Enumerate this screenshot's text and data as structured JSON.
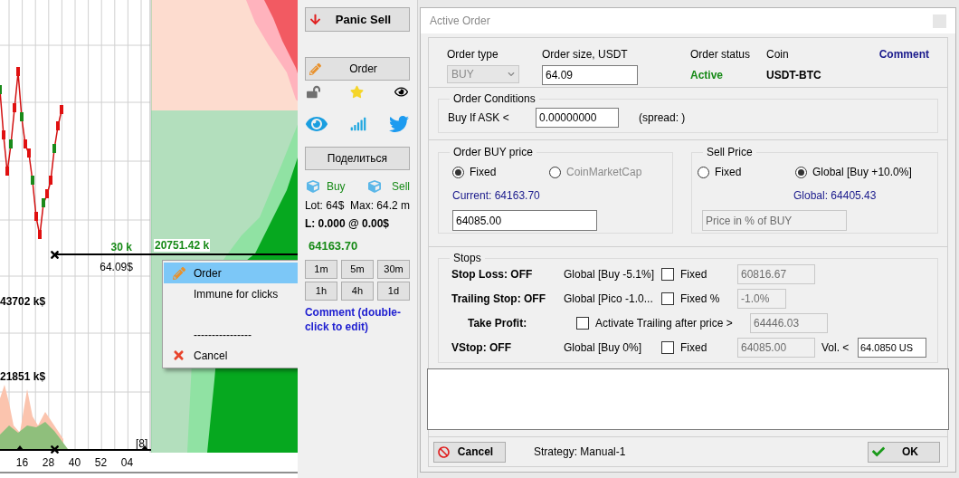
{
  "chart": {
    "order_volume": "30 k",
    "order_total": "20751.42 k",
    "order_price": "64.09$",
    "volume_labels": [
      "43702 k$",
      "21851 k$"
    ],
    "marker": "[8]",
    "x_labels": [
      "16",
      "28",
      "40",
      "52",
      "04"
    ]
  },
  "context_menu": [
    {
      "kind": "edit",
      "label": "Order",
      "selected": true
    },
    {
      "kind": "plain",
      "label": "Immune for clicks",
      "selected": false
    },
    {
      "kind": "spacer"
    },
    {
      "kind": "separator",
      "label": "----------------"
    },
    {
      "kind": "cancel",
      "label": "Cancel",
      "selected": false
    }
  ],
  "panel": {
    "panic_button": "Panic Sell",
    "order_button": "Order",
    "share_button": "Поделиться",
    "buy": "Buy",
    "sell": "Sell",
    "lot": "Lot: 64$  Max: 64.2 m",
    "position": "L: 0.000 @ 0.00$",
    "price": "64163.70",
    "timeframes": [
      "1m",
      "5m",
      "30m",
      "1h",
      "4h",
      "1d"
    ],
    "comment": "Comment (double-click to edit)"
  },
  "dialog": {
    "title": "Active Order",
    "order_type": {
      "label": "Order type",
      "value": "BUY",
      "disabled": true
    },
    "order_size": {
      "label": "Order size, USDT",
      "value": "64.09"
    },
    "status": {
      "label": "Order status",
      "value": "Active"
    },
    "coin": {
      "label": "Coin",
      "value": "USDT-BTC"
    },
    "comment_link": "Comment",
    "conditions": {
      "title": "Order Conditions",
      "label": "Buy If ASK <",
      "value": "0.00000000",
      "spread": "(spread: )"
    },
    "buy_price": {
      "title": "Order BUY price",
      "options": [
        {
          "label": "Fixed",
          "selected": true,
          "disabled": false
        },
        {
          "label": "CoinMarketCap",
          "selected": false,
          "disabled": true
        }
      ],
      "current": "Current: 64163.70",
      "value": "64085.00"
    },
    "sell_price": {
      "title": "Sell Price",
      "options": [
        {
          "label": "Fixed",
          "selected": false,
          "disabled": false
        },
        {
          "label": "Global [Buy +10.0%]",
          "selected": true,
          "disabled": false
        }
      ],
      "global": "Global: 64405.43",
      "placeholder": "Price in % of BUY"
    },
    "stops": {
      "title": "Stops",
      "rows": [
        {
          "kind": "stop",
          "label": "Stop Loss: OFF",
          "mode": "Global [Buy -5.1%]",
          "check_label": "Fixed",
          "checked": false,
          "value": "60816.67"
        },
        {
          "kind": "stop",
          "label": "Trailing Stop: OFF",
          "mode": "Global [Pico -1.0...",
          "check_label": "Fixed %",
          "checked": false,
          "value": "-1.0%"
        },
        {
          "kind": "activation",
          "label": "Take Profit:",
          "check_label": "Activate Trailing after price >",
          "checked": false,
          "value": "64446.03"
        },
        {
          "kind": "stop",
          "label": "VStop: OFF",
          "mode": "Global [Buy 0%]",
          "check_label": "Fixed",
          "checked": false,
          "value": "64085.00",
          "vol_label": "Vol. <",
          "vol_value": "64.0850 US"
        }
      ]
    },
    "cancel_button": "Cancel",
    "strategy": "Strategy: Manual-1",
    "ok_button": "OK"
  }
}
